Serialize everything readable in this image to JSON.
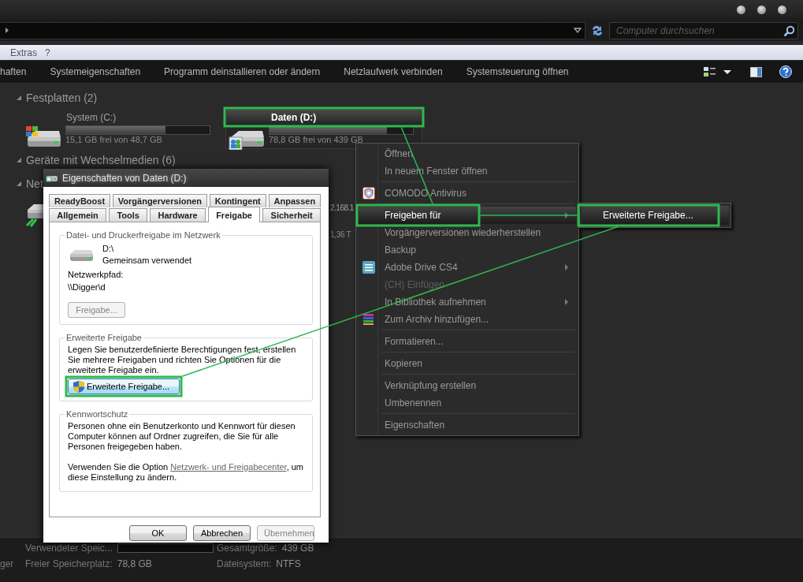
{
  "address_bar": {
    "search_placeholder": "Computer durchsuchen"
  },
  "menu_bar": [
    "Extras",
    "?"
  ],
  "toolbar": [
    "haften",
    "Systemeigenschaften",
    "Programm deinstallieren oder ändern",
    "Netzlaufwerk verbinden",
    "Systemsteuerung öffnen"
  ],
  "groups": [
    {
      "title": "Festplatten (2)",
      "drives": [
        {
          "kind": "system",
          "name": "System (C:)",
          "level": 0.69,
          "free": "15,1 GB frei von 48,7 GB",
          "selected": false
        },
        {
          "kind": "shared",
          "name": "Daten (D:)",
          "level": 0.82,
          "free": "78,8 GB frei von 439 GB",
          "selected": true
        }
      ]
    },
    {
      "title": "Geräte mit Wechselmedien (6)"
    },
    {
      "title": "Net",
      "drives": [
        {
          "kind": "network",
          "name": "2.168.1",
          "free": "1,36 T",
          "selected": false
        }
      ]
    }
  ],
  "details": {
    "cut_text": "ger",
    "fields": [
      {
        "kind": "bar",
        "label": "Verwendeter Speic..."
      },
      {
        "kind": "text",
        "label": "Gesamtgröße:",
        "value": "439 GB"
      },
      {
        "kind": "text",
        "label": "Freier Speicherplatz:",
        "value": "78,8 GB"
      },
      {
        "kind": "text",
        "label": "Dateisystem:",
        "value": "NTFS"
      }
    ]
  },
  "dialog": {
    "title": "Eigenschaften von Daten (D:)",
    "tab_rows": [
      [
        {
          "label": "ReadyBoost",
          "selected": false
        },
        {
          "label": "Vorgängerversionen",
          "selected": false
        },
        {
          "label": "Kontingent",
          "selected": false
        },
        {
          "label": "Anpassen",
          "selected": false
        }
      ],
      [
        {
          "label": "Allgemein",
          "selected": false
        },
        {
          "label": "Tools",
          "selected": false
        },
        {
          "label": "Hardware",
          "selected": false
        },
        {
          "label": "Freigabe",
          "selected": true
        },
        {
          "label": "Sicherheit",
          "selected": false
        }
      ]
    ],
    "sections": [
      {
        "kind": "share",
        "title": "Datei- und Druckerfreigabe im Netzwerk",
        "path": "D:\\",
        "status": "Gemeinsam verwendet",
        "network_path_label": "Netzwerkpfad:",
        "network_path": "\\\\Digger\\d",
        "button": {
          "label": "Freigabe...",
          "disabled": true
        }
      },
      {
        "kind": "advanced",
        "title": "Erweiterte Freigabe",
        "text": "Legen Sie benutzerdefinierte Berechtigungen fest, erstellen Sie mehrere Freigaben und richten Sie Optionen für die erweiterte Freigabe ein.",
        "button": {
          "label": "Erweiterte Freigabe...",
          "disabled": false
        }
      },
      {
        "kind": "password",
        "title": "Kennwortschutz",
        "text": "Personen ohne ein Benutzerkonto und Kennwort für diesen Computer können auf Ordner zugreifen, die Sie für alle Personen freigegeben haben.",
        "note": {
          "before": "Verwenden Sie die Option ",
          "link": "Netzwerk- und Freigabecenter",
          "after": ", um diese Einstellung zu ändern."
        }
      }
    ],
    "buttons": [
      {
        "label": "OK",
        "disabled": false
      },
      {
        "label": "Abbrechen",
        "disabled": false
      },
      {
        "label": "Übernehmen",
        "disabled": true
      }
    ]
  },
  "context_menu": {
    "items": [
      {
        "kind": "item",
        "label": "Öffnen",
        "selected": false,
        "disabled": false,
        "submenu": false
      },
      {
        "kind": "item",
        "label": "In neuem Fenster öffnen",
        "selected": false,
        "disabled": false,
        "submenu": false
      },
      {
        "kind": "separator"
      },
      {
        "kind": "shield",
        "label": "COMODO Antivirus",
        "selected": false,
        "disabled": false,
        "submenu": false
      },
      {
        "kind": "separator"
      },
      {
        "kind": "item",
        "label": "Freigeben für",
        "selected": true,
        "disabled": false,
        "submenu": true
      },
      {
        "kind": "item",
        "label": "Vorgängerversionen wiederherstellen",
        "selected": false,
        "disabled": false,
        "submenu": false
      },
      {
        "kind": "item",
        "label": "Backup",
        "selected": false,
        "disabled": false,
        "submenu": false
      },
      {
        "kind": "list",
        "label": "Adobe Drive CS4",
        "selected": false,
        "disabled": false,
        "submenu": true
      },
      {
        "kind": "item",
        "label": "(CH) Einfügen",
        "selected": false,
        "disabled": true,
        "submenu": false
      },
      {
        "kind": "item",
        "label": "In Bibliothek aufnehmen",
        "selected": false,
        "disabled": false,
        "submenu": true
      },
      {
        "kind": "books",
        "label": "Zum Archiv hinzufügen...",
        "selected": false,
        "disabled": false,
        "submenu": false
      },
      {
        "kind": "separator"
      },
      {
        "kind": "item",
        "label": "Formatieren...",
        "selected": false,
        "disabled": false,
        "submenu": false
      },
      {
        "kind": "separator"
      },
      {
        "kind": "item",
        "label": "Kopieren",
        "selected": false,
        "disabled": false,
        "submenu": false
      },
      {
        "kind": "separator"
      },
      {
        "kind": "item",
        "label": "Verknüpfung erstellen",
        "selected": false,
        "disabled": false,
        "submenu": false
      },
      {
        "kind": "item",
        "label": "Umbenennen",
        "selected": false,
        "disabled": false,
        "submenu": false
      },
      {
        "kind": "separator"
      },
      {
        "kind": "item",
        "label": "Eigenschaften",
        "selected": false,
        "disabled": false,
        "submenu": false
      }
    ],
    "submenu": [
      {
        "label": "Erweiterte Freigabe...",
        "selected": true
      }
    ]
  }
}
